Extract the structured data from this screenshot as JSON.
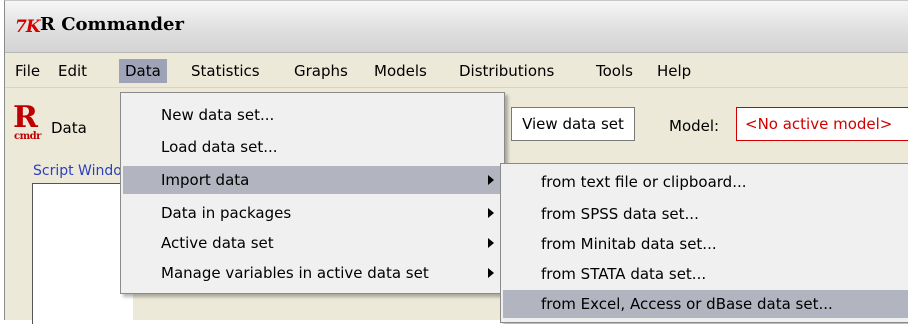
{
  "window": {
    "title": "R Commander",
    "app_icon_text": "7K"
  },
  "menubar": {
    "items": [
      {
        "label": "File"
      },
      {
        "label": "Edit"
      },
      {
        "label": "Data"
      },
      {
        "label": "Statistics"
      },
      {
        "label": "Graphs"
      },
      {
        "label": "Models"
      },
      {
        "label": "Distributions"
      },
      {
        "label": "Tools"
      },
      {
        "label": "Help"
      }
    ],
    "active": "Data"
  },
  "toolbar": {
    "logo_text": "R",
    "logo_sub": "cmdr",
    "data_label": "Data",
    "view_data_button": "View data set",
    "model_label": "Model:",
    "model_value": "<No active model>"
  },
  "script": {
    "tab_label": "Script Window"
  },
  "data_menu": {
    "items": [
      {
        "label": "New data set...",
        "has_submenu": false
      },
      {
        "label": "Load data set...",
        "has_submenu": false
      },
      {
        "label": "Import data",
        "has_submenu": true,
        "highlighted": true
      },
      {
        "label": "Data in packages",
        "has_submenu": true
      },
      {
        "label": "Active data set",
        "has_submenu": true
      },
      {
        "label": "Manage variables in active data set",
        "has_submenu": true
      }
    ]
  },
  "import_submenu": {
    "items": [
      {
        "label": "from text file or clipboard..."
      },
      {
        "label": "from SPSS data set..."
      },
      {
        "label": "from Minitab data set..."
      },
      {
        "label": "from STATA data set..."
      },
      {
        "label": "from Excel, Access or dBase data set...",
        "highlighted": true
      }
    ]
  },
  "colors": {
    "accent_red": "#d00000",
    "menu_highlight": "#9ea3b8",
    "script_tab_blue": "#2b3fc0"
  }
}
